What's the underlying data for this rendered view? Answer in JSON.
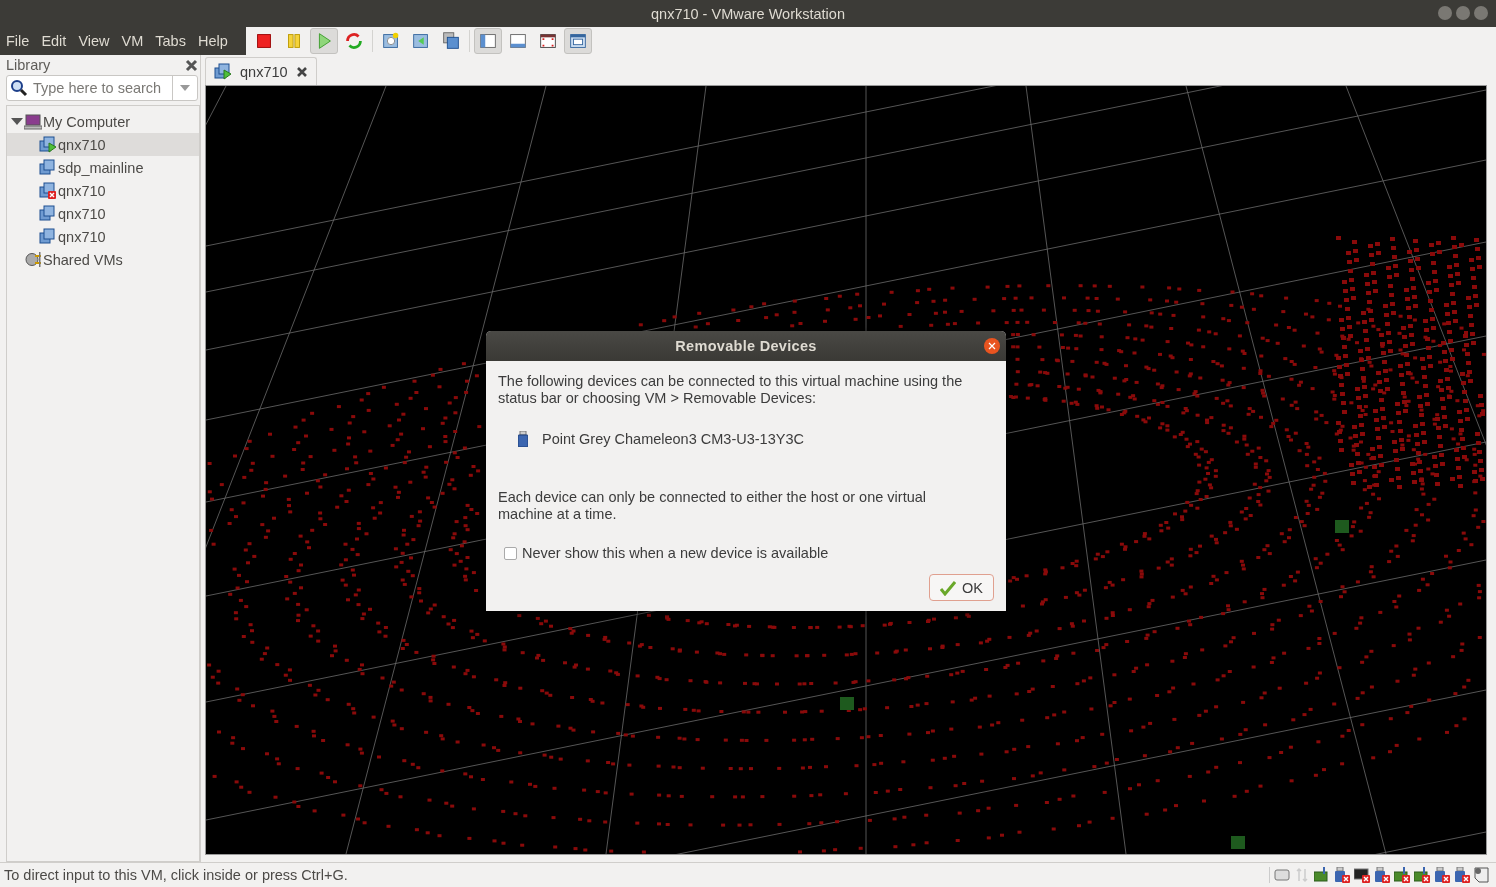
{
  "window": {
    "title": "qnx710 - VMware Workstation"
  },
  "menu": [
    "File",
    "Edit",
    "View",
    "VM",
    "Tabs",
    "Help"
  ],
  "toolbar": [
    {
      "pressed": false
    },
    {
      "pressed": false
    },
    {
      "pressed": true
    },
    {
      "pressed": false
    },
    {
      "pressed": false
    },
    {
      "pressed": false
    },
    {
      "pressed": false
    },
    {
      "pressed": true
    },
    {
      "pressed": false
    },
    {
      "pressed": false
    },
    {
      "pressed": true
    }
  ],
  "library": {
    "title": "Library",
    "search": {
      "placeholder": "Type here to search"
    },
    "tree": [
      {
        "label": "My Computer",
        "kind": "computer",
        "expanded": true,
        "selected": false,
        "children": [
          {
            "label": "qnx710",
            "kind": "running",
            "selected": true
          },
          {
            "label": "sdp_mainline",
            "kind": "vm",
            "selected": false
          },
          {
            "label": "qnx710",
            "kind": "failed",
            "selected": false
          },
          {
            "label": "qnx710",
            "kind": "vm",
            "selected": false
          },
          {
            "label": "qnx710",
            "kind": "vm",
            "selected": false
          }
        ]
      },
      {
        "label": "Shared VMs",
        "kind": "shared",
        "selected": false
      }
    ]
  },
  "tabs": [
    {
      "label": "qnx710",
      "selected": true
    }
  ],
  "dialog": {
    "title": "Removable Devices",
    "message": "The following devices can be connected to this virtual machine using the status bar or choosing VM > Removable Devices:",
    "devices": [
      "Point Grey Chameleon3 CM3-U3-13Y3C"
    ],
    "note": "Each device can only be connected to either the host or one virtual machine at a time.",
    "checkbox": {
      "label": "Never show this when a new device is available",
      "checked": false
    },
    "ok": "OK"
  },
  "status_bar": {
    "text": "To direct input to this VM, click inside or press Ctrl+G."
  }
}
